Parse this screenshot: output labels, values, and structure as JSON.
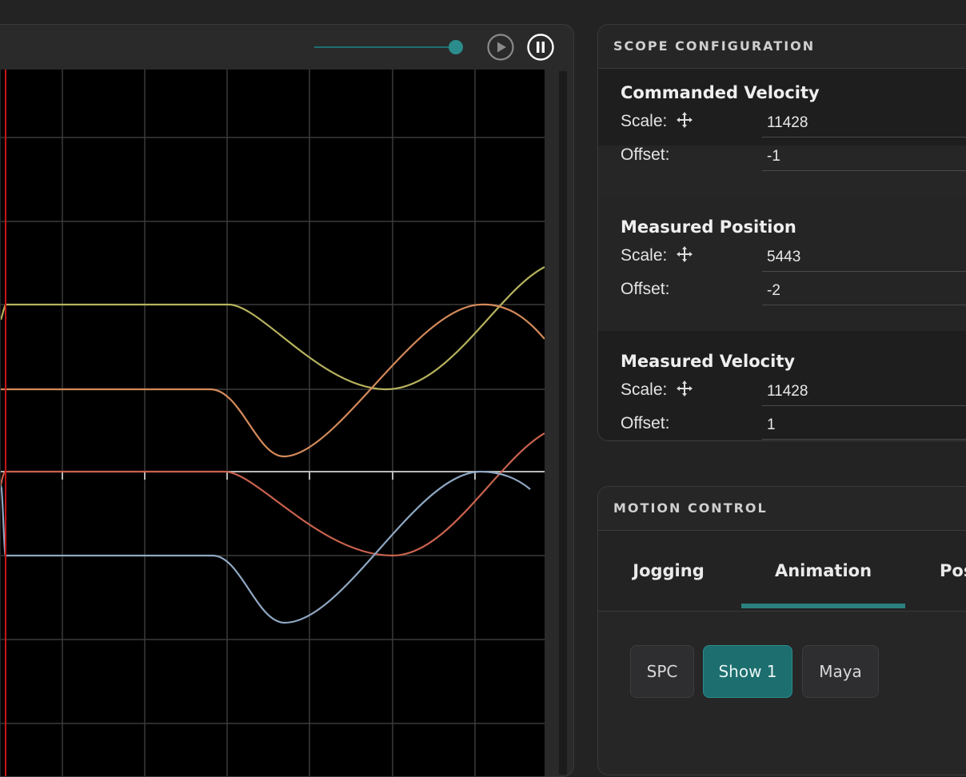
{
  "scope": {
    "speed_slider": {
      "level": 1.0
    },
    "buttons": {
      "play": "play-icon",
      "pause": "pause-icon"
    },
    "colors": {
      "background": "#000000",
      "grid": "#3a3a3a",
      "cursor": "#c41616",
      "baseline": "#b9b9b9",
      "series": [
        "#b7b35e",
        "#d38a5a",
        "#c9624e",
        "#8fa7c2"
      ]
    }
  },
  "scope_config": {
    "title": "SCOPE CONFIGURATION",
    "groups": [
      {
        "name": "Commanded Velocity",
        "scale_label": "Scale:",
        "scale": "11428",
        "offset_label": "Offset:",
        "offset": "-1"
      },
      {
        "name": "Measured Position",
        "scale_label": "Scale:",
        "scale": "5443",
        "offset_label": "Offset:",
        "offset": "-2"
      },
      {
        "name": "Measured Velocity",
        "scale_label": "Scale:",
        "scale": "11428",
        "offset_label": "Offset:",
        "offset": "1"
      }
    ]
  },
  "motion_control": {
    "title": "MOTION CONTROL",
    "tabs": [
      "Jogging",
      "Animation",
      "Pos"
    ],
    "active_tab": "Animation",
    "presets": [
      "SPC",
      "Show 1",
      "Maya"
    ],
    "active_preset": "Show 1",
    "accent": "#2b8080"
  }
}
